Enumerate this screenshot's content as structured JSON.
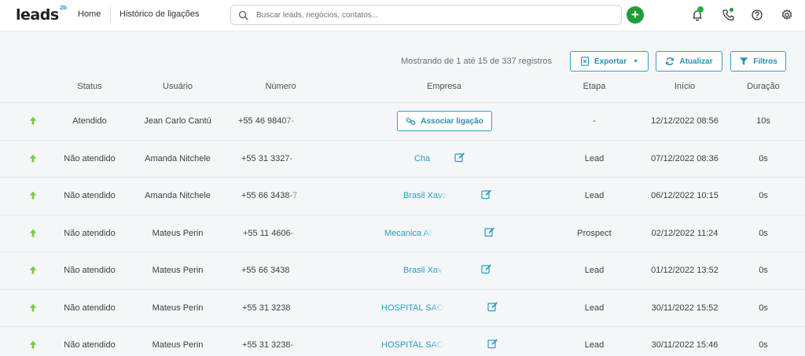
{
  "app": {
    "logo": "leads",
    "logo_sup": "2b"
  },
  "nav": {
    "home": "Home",
    "current": "Histórico de ligações"
  },
  "search": {
    "placeholder": "Buscar leads, negócios, contatos..."
  },
  "toolbar": {
    "records": "Mostrando de 1 até 15 de 337 registros",
    "export_label": "Exportar",
    "refresh_label": "Atualizar",
    "filters_label": "Filtros"
  },
  "columns": {
    "status": "Status",
    "user": "Usuário",
    "number": "Número",
    "company": "Empresa",
    "stage": "Etapa",
    "start": "Início",
    "duration": "Duração"
  },
  "rows": [
    {
      "direction": "outgoing",
      "status": "Atendido",
      "user": "Jean Carlo Cantú",
      "number": "+55 46 98407-",
      "company": "",
      "action": "Associar ligação",
      "stage": "-",
      "start": "12/12/2022 08:56",
      "duration": "10s"
    },
    {
      "direction": "outgoing",
      "status": "Não atendido",
      "user": "Amanda Nitchele",
      "number": "+55 31 3327-",
      "company": "Cha",
      "action": "",
      "stage": "Lead",
      "start": "07/12/2022 08:36",
      "duration": "0s"
    },
    {
      "direction": "outgoing",
      "status": "Não atendido",
      "user": "Amanda Nitchele",
      "number": "+55 66 3438-7",
      "company": "Brasil Xava",
      "action": "",
      "stage": "Lead",
      "start": "06/12/2022 10:15",
      "duration": "0s"
    },
    {
      "direction": "outgoing",
      "status": "Não atendido",
      "user": "Mateus Perin",
      "number": "+55 11 4606-",
      "company": "Mecanica Alv",
      "action": "",
      "stage": "Prospect",
      "start": "02/12/2022 11:24",
      "duration": "0s"
    },
    {
      "direction": "outgoing",
      "status": "Não atendido",
      "user": "Mateus Perin",
      "number": "+55 66 3438",
      "company": "Brasil Xav",
      "action": "",
      "stage": "Lead",
      "start": "01/12/2022 13:52",
      "duration": "0s"
    },
    {
      "direction": "outgoing",
      "status": "Não atendido",
      "user": "Mateus Perin",
      "number": "+55 31 3238",
      "company": "HOSPITAL SAO",
      "action": "",
      "stage": "Lead",
      "start": "30/11/2022 15:52",
      "duration": "0s"
    },
    {
      "direction": "outgoing",
      "status": "Não atendido",
      "user": "Mateus Perin",
      "number": "+55 31 3238-",
      "company": "HOSPITAL SAO",
      "action": "",
      "stage": "Lead",
      "start": "30/11/2022 15:46",
      "duration": "0s"
    }
  ],
  "colors": {
    "accent": "#2aa2c7",
    "add": "#1f9d3a",
    "arrow": "#7ac943"
  }
}
